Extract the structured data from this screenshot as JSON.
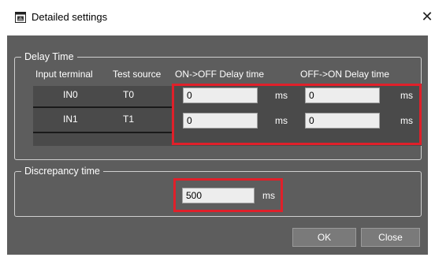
{
  "window": {
    "title": "Detailed settings",
    "close_glyph": "✕"
  },
  "delay_time": {
    "group_label": "Delay Time",
    "headers": {
      "input_terminal": "Input terminal",
      "test_source": "Test source",
      "on_off": "ON->OFF Delay time",
      "off_on": "OFF->ON Delay time"
    },
    "rows": [
      {
        "terminal": "IN0",
        "source": "T0",
        "on_off_value": "0",
        "on_off_unit": "ms",
        "off_on_value": "0",
        "off_on_unit": "ms"
      },
      {
        "terminal": "IN1",
        "source": "T1",
        "on_off_value": "0",
        "on_off_unit": "ms",
        "off_on_value": "0",
        "off_on_unit": "ms"
      }
    ]
  },
  "discrepancy": {
    "group_label": "Discrepancy time",
    "value": "500",
    "unit": "ms"
  },
  "buttons": {
    "ok": "OK",
    "close": "Close"
  },
  "colors": {
    "panel_bg": "#5d5d5d",
    "highlight": "#e0202a"
  }
}
